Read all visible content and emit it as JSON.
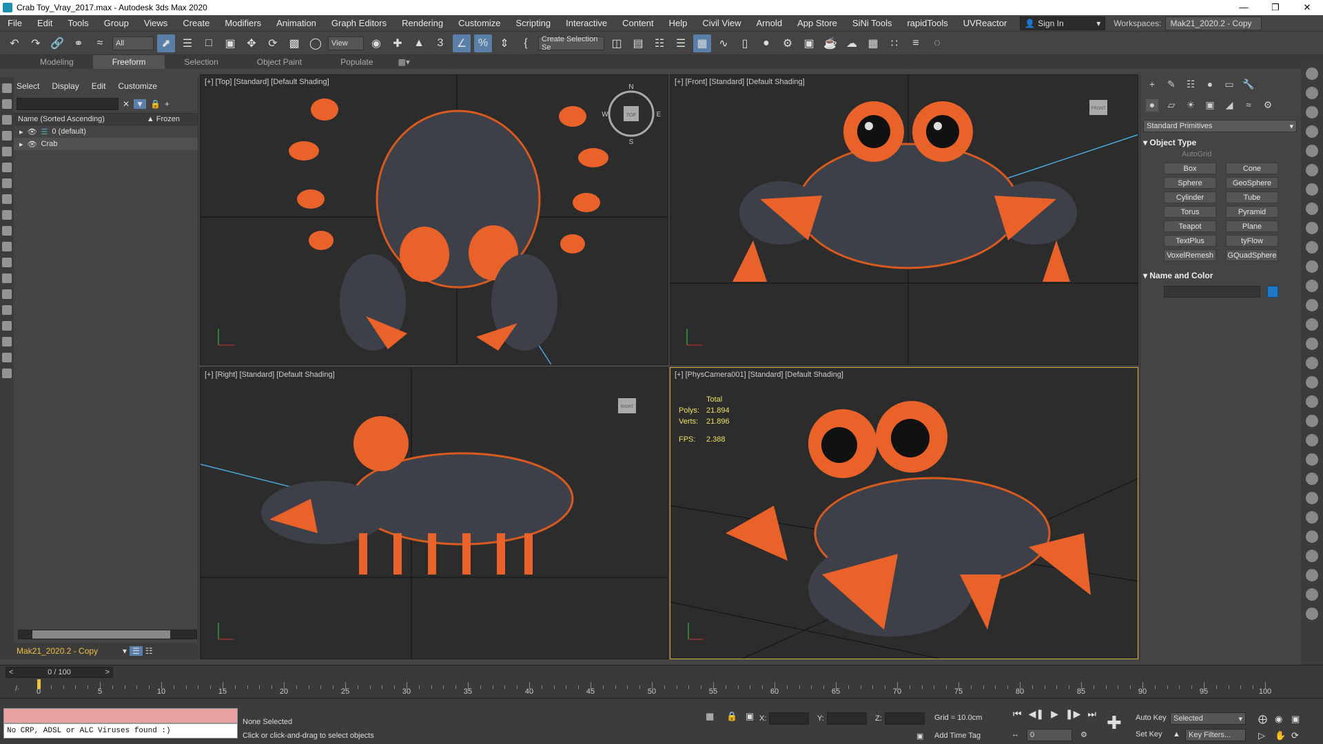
{
  "window": {
    "title": "Crab Toy_Vray_2017.max - Autodesk 3ds Max 2020",
    "controls": [
      "—",
      "❐",
      "✕"
    ]
  },
  "menu": [
    "File",
    "Edit",
    "Tools",
    "Group",
    "Views",
    "Create",
    "Modifiers",
    "Animation",
    "Graph Editors",
    "Rendering",
    "Customize",
    "Scripting",
    "Interactive",
    "Content",
    "Help",
    "Civil View",
    "Arnold",
    "App Store",
    "SiNi Tools",
    "rapidTools",
    "UVReactor"
  ],
  "account": {
    "sign_in": "Sign In",
    "workspaces_label": "Workspaces:",
    "workspace": "Mak21_2020.2 - Copy"
  },
  "toolbar": {
    "filter": "All",
    "ref_coord": "View",
    "selection_set": "Create Selection Se"
  },
  "ribbon": {
    "tabs": [
      "Modeling",
      "Freeform",
      "Selection",
      "Object Paint",
      "Populate"
    ],
    "active": "Freeform"
  },
  "scene_explorer": {
    "menu": [
      "Select",
      "Display",
      "Edit",
      "Customize"
    ],
    "column_name": "Name (Sorted Ascending)",
    "column_frozen": "▲ Frozen",
    "rows": [
      {
        "name": "0 (default)"
      },
      {
        "name": "Crab"
      }
    ],
    "workspace": "Mak21_2020.2 - Copy"
  },
  "viewports": {
    "top": {
      "label": "[+] [Top] [Standard] [Default Shading]",
      "compass": {
        "n": "N",
        "s": "S",
        "e": "E",
        "w": "W",
        "cube": "TOP"
      }
    },
    "front": {
      "label": "[+] [Front] [Standard] [Default Shading]",
      "cube": "FRONT"
    },
    "right": {
      "label": "[+] [Right] [Standard] [Default Shading]",
      "cube": "RIGHT"
    },
    "camera": {
      "label": "[+] [PhysCamera001] [Standard] [Default Shading]",
      "stats": {
        "header": "Total",
        "polys_label": "Polys:",
        "polys": "21.894",
        "verts_label": "Verts:",
        "verts": "21.896",
        "fps_label": "FPS:",
        "fps": "2.388"
      }
    }
  },
  "command_panel": {
    "category": "Standard Primitives",
    "object_type_title": "Object Type",
    "autogrid": "AutoGrid",
    "objects": [
      "Box",
      "Cone",
      "Sphere",
      "GeoSphere",
      "Cylinder",
      "Tube",
      "Torus",
      "Pyramid",
      "Teapot",
      "Plane",
      "TextPlus",
      "tyFlow",
      "VoxelRemesh",
      "GQuadSphere"
    ],
    "name_color_title": "Name and Color",
    "color": "#1e78c8"
  },
  "timeline": {
    "frame": "0 / 100",
    "ticks": [
      0,
      5,
      10,
      15,
      20,
      25,
      30,
      35,
      40,
      45,
      50,
      55,
      60,
      65,
      70,
      75,
      80,
      85,
      90,
      95,
      100
    ]
  },
  "status": {
    "script_output": "No CRP, ADSL or ALC Viruses found :)",
    "selection": "None Selected",
    "prompt": "Click or click-and-drag to select objects",
    "x_label": "X:",
    "y_label": "Y:",
    "z_label": "Z:",
    "grid": "Grid = 10.0cm",
    "add_time_tag": "Add Time Tag",
    "auto_key": "Auto Key",
    "set_key": "Set Key",
    "key_mode": "Selected",
    "key_filters": "Key Filters...",
    "frame_value": "0"
  }
}
